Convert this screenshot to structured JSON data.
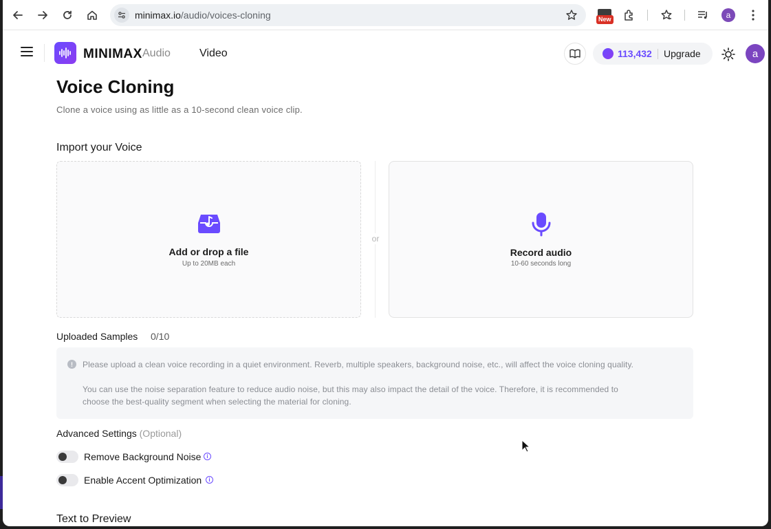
{
  "browser": {
    "url_domain": "minimax.io",
    "url_path": "/audio/voices-cloning",
    "extension_badge": "New",
    "profile_initial": "a"
  },
  "header": {
    "logo_text": "MINIMAX",
    "nav": {
      "audio": "Audio",
      "video": "Video"
    },
    "credits": "113,432",
    "upgrade_label": "Upgrade",
    "avatar_initial": "a",
    "accent_color": "#6a4bff"
  },
  "page": {
    "title": "Voice Cloning",
    "subtitle": "Clone a voice using as little as a 10-second clean voice clip."
  },
  "import": {
    "title": "Import your Voice",
    "upload": {
      "label": "Add or drop a file",
      "hint": "Up to 20MB each"
    },
    "or": "or",
    "record": {
      "label": "Record audio",
      "hint": "10-60 seconds long"
    }
  },
  "samples": {
    "title": "Uploaded Samples",
    "count": "0/10",
    "notice_1": "Please upload a clean voice recording in a quiet environment. Reverb, multiple speakers, background noise, etc., will affect the voice cloning quality.",
    "notice_2a": "You can use the noise separation feature to reduce audio noise, but this may also impact the detail of the voice. Therefore, it is recommended to",
    "notice_2b": "choose the best-quality segment when selecting the material for cloning."
  },
  "advanced": {
    "title": "Advanced Settings",
    "optional": "(Optional)",
    "options": [
      {
        "label": "Remove Background Noise",
        "enabled": false
      },
      {
        "label": "Enable Accent Optimization",
        "enabled": false
      }
    ]
  },
  "preview": {
    "title": "Text to Preview"
  }
}
